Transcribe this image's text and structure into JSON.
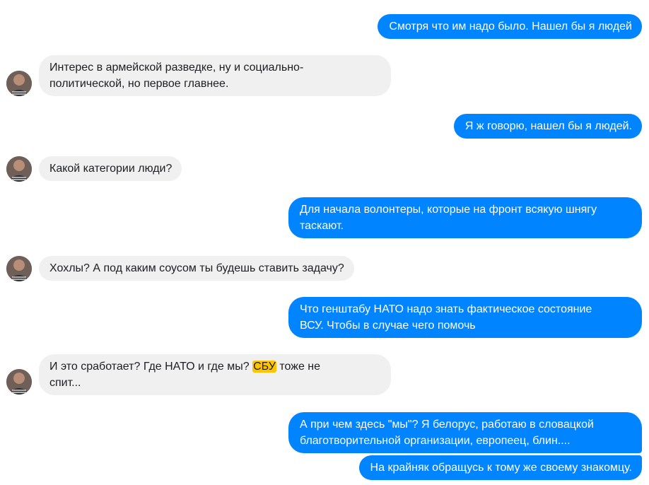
{
  "conversation": {
    "messages": [
      {
        "side": "out",
        "lines": [
          "Смотря что им надо было. Нашел бы я людей"
        ]
      },
      {
        "side": "in",
        "lines": [
          "Интерес в армейской разведке, ну и социально-",
          "политической, но первое главнее."
        ]
      },
      {
        "side": "out",
        "lines": [
          "Я ж говорю, нашел бы я людей."
        ]
      },
      {
        "side": "in",
        "lines": [
          "Какой категории люди?"
        ]
      },
      {
        "side": "out",
        "lines": [
          "Для начала волонтеры, которые на фронт всякую шнягу",
          "таскают."
        ]
      },
      {
        "side": "in",
        "lines": [
          "Хохлы? А под каким соусом ты будешь ставить задачу?"
        ]
      },
      {
        "side": "out",
        "lines": [
          "Что генштабу НАТО надо знать фактическое состояние",
          "ВСУ. Чтобы в случае чего помочь"
        ]
      },
      {
        "side": "in",
        "lines": [
          "И это сработает? Где НАТО и где мы? ",
          "СБУ",
          " тоже не",
          "спит..."
        ],
        "highlight_term": "СБУ"
      },
      {
        "side": "out",
        "lines": [
          "А при чем здесь \"мы\"? Я белорус, работаю в словацкой",
          "благотворительной организации, европеец, блин...."
        ]
      },
      {
        "side": "out",
        "lines": [
          "На крайняк обращусь к тому же своему знакомцу."
        ]
      }
    ]
  },
  "colors": {
    "outgoing_bubble": "#0084ff",
    "incoming_bubble": "#f0f0f0",
    "highlight": "#ffc400"
  }
}
